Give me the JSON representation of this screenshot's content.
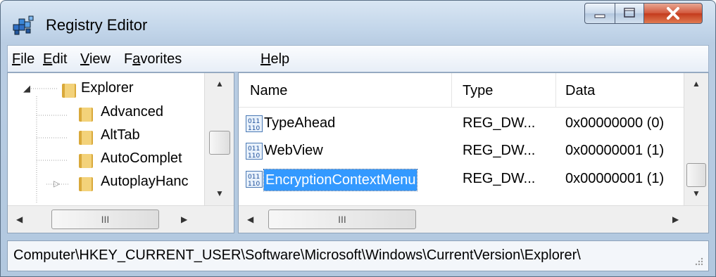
{
  "window": {
    "title": "Registry Editor"
  },
  "menu": [
    {
      "label": "File",
      "u": "F",
      "rest": "ile"
    },
    {
      "label": "Edit",
      "u": "E",
      "rest": "dit"
    },
    {
      "label": "View",
      "u": "V",
      "rest": "iew"
    },
    {
      "label": "Favorites",
      "pre": "F",
      "u": "a",
      "rest": "vorites"
    },
    {
      "label": "Help",
      "u": "H",
      "rest": "elp"
    }
  ],
  "tree": {
    "root": "Explorer",
    "children": [
      "Advanced",
      "AltTab",
      "AutoComplet",
      "AutoplayHanc"
    ]
  },
  "list": {
    "headers": {
      "name": "Name",
      "type": "Type",
      "data": "Data"
    },
    "rows": [
      {
        "name": "TypeAhead",
        "type": "REG_DW...",
        "data": "0x00000000 (0)",
        "selected": false
      },
      {
        "name": "WebView",
        "type": "REG_DW...",
        "data": "0x00000001 (1)",
        "selected": false
      },
      {
        "name": "EncryptionContextMenu",
        "type": "REG_DW...",
        "data": "0x00000001 (1)",
        "selected": true
      }
    ]
  },
  "scroll": {
    "left_hthumb": "III",
    "right_hthumb": "III"
  },
  "status": {
    "path": "Computer\\HKEY_CURRENT_USER\\Software\\Microsoft\\Windows\\CurrentVersion\\Explorer\\"
  },
  "colors": {
    "selection": "#3399ff",
    "close": "#c33a1c"
  }
}
